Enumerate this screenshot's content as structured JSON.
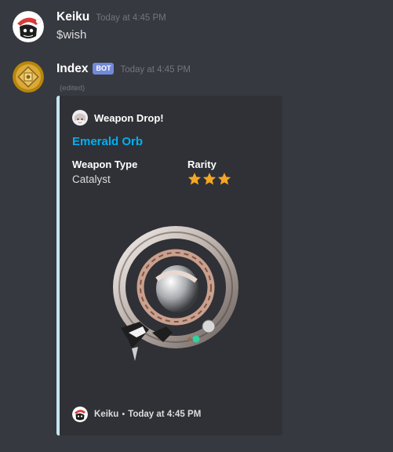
{
  "messages": [
    {
      "username": "Keiku",
      "timestamp": "Today at 4:45 PM",
      "content": "$wish"
    },
    {
      "username": "Index",
      "bot_tag": "BOT",
      "timestamp": "Today at 4:45 PM",
      "edited": "(edited)",
      "embed": {
        "accent_color": "#c6e5f0",
        "author": "Weapon Drop!",
        "title": "Emerald Orb",
        "fields": [
          {
            "name": "Weapon Type",
            "value": "Catalyst"
          },
          {
            "name": "Rarity",
            "stars": 3
          }
        ],
        "image": "catalyst-orb-image",
        "footer": {
          "name": "Keiku",
          "separator": "•",
          "timestamp": "Today at 4:45 PM"
        }
      }
    }
  ],
  "colors": {
    "background": "#36393f",
    "embed_background": "#2f3136",
    "title_link": "#00b0f4",
    "bot_tag": "#7289da",
    "star": "#f5a623"
  }
}
